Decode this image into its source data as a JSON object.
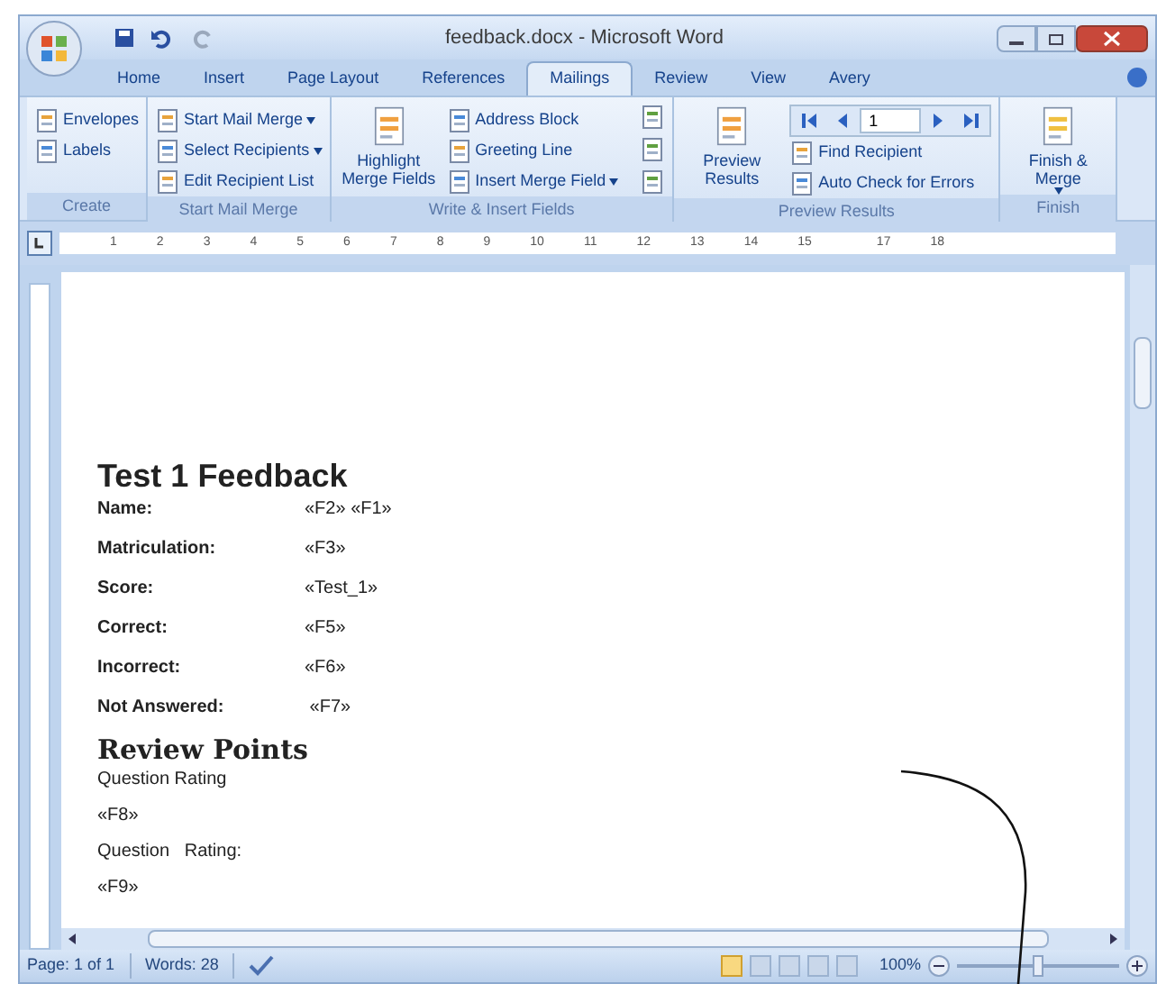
{
  "window": {
    "title": "feedback.docx - Microsoft Word"
  },
  "tabs": [
    {
      "label": "Home",
      "selected": false
    },
    {
      "label": "Insert",
      "selected": false
    },
    {
      "label": "Page Layout",
      "selected": false
    },
    {
      "label": "References",
      "selected": false
    },
    {
      "label": "Mailings",
      "selected": true
    },
    {
      "label": "Review",
      "selected": false
    },
    {
      "label": "View",
      "selected": false
    },
    {
      "label": "Avery",
      "selected": false
    }
  ],
  "ribbon_groups": [
    {
      "label": "Create",
      "items": [
        {
          "kind": "small",
          "label": "Envelopes",
          "dropdown": false
        },
        {
          "kind": "small",
          "label": "Labels",
          "dropdown": false
        }
      ]
    },
    {
      "label": "Start Mail Merge",
      "items": [
        {
          "kind": "small",
          "label": "Start Mail Merge",
          "dropdown": true
        },
        {
          "kind": "small",
          "label": "Select Recipients",
          "dropdown": true
        },
        {
          "kind": "small",
          "label": "Edit Recipient List",
          "dropdown": false
        }
      ]
    },
    {
      "label": "Write & Insert Fields",
      "items": [
        {
          "kind": "large",
          "label": "Highlight Merge Fields",
          "dropdown": false
        },
        {
          "kind": "small",
          "label": "Address Block",
          "dropdown": false
        },
        {
          "kind": "small",
          "label": "Greeting Line",
          "dropdown": false
        },
        {
          "kind": "small",
          "label": "Insert Merge Field",
          "dropdown": true
        },
        {
          "kind": "iconcol"
        }
      ]
    },
    {
      "label": "Preview Results",
      "items": [
        {
          "kind": "large",
          "label": "Preview Results",
          "dropdown": false
        },
        {
          "kind": "nav",
          "record": "1"
        },
        {
          "kind": "small",
          "label": "Find Recipient",
          "dropdown": false
        },
        {
          "kind": "small",
          "label": "Auto Check for Errors",
          "dropdown": false
        }
      ]
    },
    {
      "label": "Finish",
      "items": [
        {
          "kind": "large",
          "label": "Finish & Merge",
          "dropdown": true
        }
      ]
    }
  ],
  "ruler": {
    "numbers": [
      "1",
      "2",
      "3",
      "4",
      "5",
      "6",
      "7",
      "8",
      "9",
      "10",
      "11",
      "12",
      "13",
      "14",
      "15",
      "17",
      "18"
    ]
  },
  "document": {
    "heading": "Test 1 Feedback",
    "fields": [
      {
        "label": "Name:",
        "value": "«F2» «F1»"
      },
      {
        "label": "Matriculation:",
        "value": "«F3»"
      },
      {
        "label": "Score:",
        "value": "«Test_1»"
      },
      {
        "label": "Correct:",
        "value": "«F5»"
      },
      {
        "label": "Incorrect:",
        "value": "«F6»"
      },
      {
        "label": "Not Answered:",
        "value": " «F7»"
      }
    ],
    "subheading": "Review Points",
    "lines": [
      "Question Rating",
      "«F8»",
      "Question   Rating:",
      "«F9»"
    ]
  },
  "status_bar": {
    "page": "Page: 1 of 1",
    "words": "Words: 28",
    "zoom": "100%",
    "zoom_slider": {
      "level": 0.5
    }
  }
}
